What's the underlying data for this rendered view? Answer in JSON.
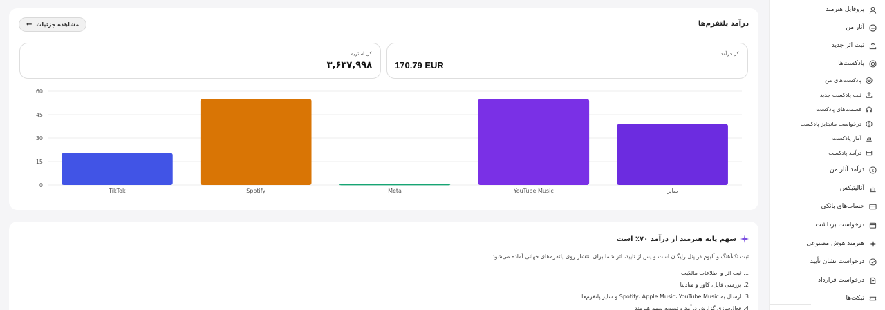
{
  "sidebar": {
    "items": [
      {
        "label": "پروفایل هنرمند",
        "icon": "user-icon"
      },
      {
        "label": "آثار من",
        "icon": "disc-icon"
      },
      {
        "label": "ثبت اثر جدید",
        "icon": "upload-icon"
      },
      {
        "label": "پادکست‌ها",
        "icon": "podcast-icon"
      },
      {
        "label": "درآمد آثار من",
        "icon": "dollar-icon"
      },
      {
        "label": "آنالیتیکس",
        "icon": "bar-chart-icon"
      },
      {
        "label": "حساب‌های بانکی",
        "icon": "card-icon"
      },
      {
        "label": "درخواست برداشت",
        "icon": "wallet-icon"
      },
      {
        "label": "هنرمند هوش مصنوعی",
        "icon": "sparkles-icon"
      },
      {
        "label": "درخواست نشان تأیید",
        "icon": "verified-icon"
      },
      {
        "label": "درخواست قرارداد",
        "icon": "contract-icon"
      },
      {
        "label": "تیکت‌ها",
        "icon": "ticket-icon"
      }
    ],
    "podcast_sub": [
      {
        "label": "پادکست‌های من",
        "icon": "podcast-icon"
      },
      {
        "label": "ثبت پادکست جدید",
        "icon": "upload-icon"
      },
      {
        "label": "قسمت‌های پادکست",
        "icon": "headphones-icon"
      },
      {
        "label": "درخواست مانیتایز پادکست",
        "icon": "dollar-icon"
      },
      {
        "label": "آمار پادکست",
        "icon": "bar-chart-icon"
      },
      {
        "label": "درآمد پادکست",
        "icon": "wallet-icon"
      }
    ]
  },
  "platform_income": {
    "title": "درآمد پلتفرم‌ها",
    "details_button": "مشاهده جزئیات",
    "total_income_label": "کل درآمد",
    "total_income_value": "170.79 EUR",
    "total_streams_label": "کل استریم",
    "total_streams_value": "۳,۶۳۷,۹۹۸"
  },
  "chart_data": {
    "type": "bar",
    "categories": [
      "TikTok",
      "Spotify",
      "Meta",
      "YouTube Music",
      "سایر"
    ],
    "values": [
      20.5,
      55,
      0.5,
      55,
      39
    ],
    "colors": [
      "#4154e6",
      "#d97505",
      "#17a574",
      "#7a30e6",
      "#6c2ce0"
    ],
    "yticks": [
      0,
      15,
      30,
      45,
      60
    ],
    "ylim": [
      0,
      60
    ],
    "grid": true
  },
  "share": {
    "title": "سهم پایه هنرمند از درآمد ۷۰٪ است",
    "intro": "ثبت تک‌آهنگ و آلبوم در پنل رایگان است و پس از تایید، اثر شما برای انتشار روی پلتفرم‌های جهانی آماده می‌شود.",
    "steps": [
      {
        "num": "1.",
        "text": "ثبت اثر و اطلاعات مالکیت"
      },
      {
        "num": "2.",
        "text": "بررسی فایل، کاور و متادیتا"
      },
      {
        "num": "3.",
        "text": "ارسال به Spotify، Apple Music، YouTube Music و سایر پلتفرم‌ها"
      },
      {
        "num": "4.",
        "text": "فعال‌سازی گزارش درآمد و تسویه سهم هنرمند"
      }
    ]
  }
}
